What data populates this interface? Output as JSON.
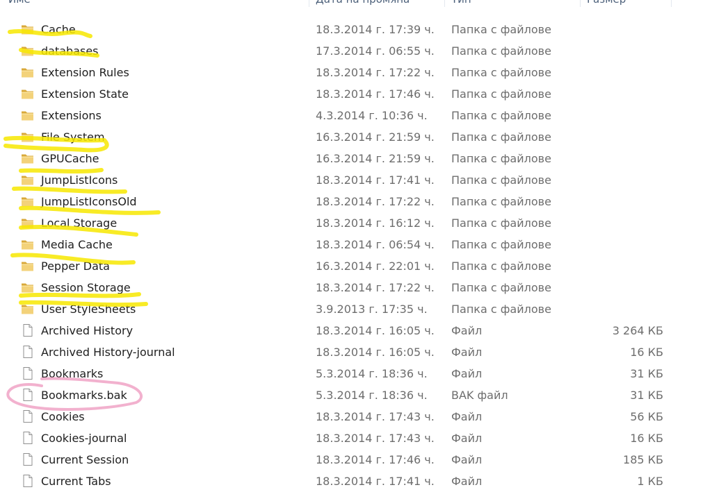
{
  "columns": {
    "name": "Име",
    "date": "Дата на промяна",
    "type": "Тип",
    "size": "Размер"
  },
  "colors": {
    "highlight_yellow": "#f7e700",
    "highlight_pink": "#f0a3c6",
    "folder": "#e8c260",
    "header_text": "#4c607a"
  },
  "files": [
    {
      "name": "Cache",
      "date": "18.3.2014 г. 17:39 ч.",
      "type": "Папка с файлове",
      "size": "",
      "icon": "folder-icon"
    },
    {
      "name": "databases",
      "date": "17.3.2014 г. 06:55 ч.",
      "type": "Папка с файлове",
      "size": "",
      "icon": "folder-icon"
    },
    {
      "name": "Extension Rules",
      "date": "18.3.2014 г. 17:22 ч.",
      "type": "Папка с файлове",
      "size": "",
      "icon": "folder-icon"
    },
    {
      "name": "Extension State",
      "date": "18.3.2014 г. 17:46 ч.",
      "type": "Папка с файлове",
      "size": "",
      "icon": "folder-icon"
    },
    {
      "name": "Extensions",
      "date": "4.3.2014 г. 10:36 ч.",
      "type": "Папка с файлове",
      "size": "",
      "icon": "folder-icon"
    },
    {
      "name": "File System",
      "date": "16.3.2014 г. 21:59 ч.",
      "type": "Папка с файлове",
      "size": "",
      "icon": "folder-icon"
    },
    {
      "name": "GPUCache",
      "date": "16.3.2014 г. 21:59 ч.",
      "type": "Папка с файлове",
      "size": "",
      "icon": "folder-icon"
    },
    {
      "name": "JumpListIcons",
      "date": "18.3.2014 г. 17:41 ч.",
      "type": "Папка с файлове",
      "size": "",
      "icon": "folder-icon"
    },
    {
      "name": "JumpListIconsOld",
      "date": "18.3.2014 г. 17:22 ч.",
      "type": "Папка с файлове",
      "size": "",
      "icon": "folder-icon"
    },
    {
      "name": "Local Storage",
      "date": "18.3.2014 г. 16:12 ч.",
      "type": "Папка с файлове",
      "size": "",
      "icon": "folder-icon"
    },
    {
      "name": "Media Cache",
      "date": "18.3.2014 г. 06:54 ч.",
      "type": "Папка с файлове",
      "size": "",
      "icon": "folder-icon"
    },
    {
      "name": "Pepper Data",
      "date": "16.3.2014 г. 22:01 ч.",
      "type": "Папка с файлове",
      "size": "",
      "icon": "folder-icon"
    },
    {
      "name": "Session Storage",
      "date": "18.3.2014 г. 17:22 ч.",
      "type": "Папка с файлове",
      "size": "",
      "icon": "folder-icon"
    },
    {
      "name": "User StyleSheets",
      "date": "3.9.2013 г. 17:35 ч.",
      "type": "Папка с файлове",
      "size": "",
      "icon": "folder-icon"
    },
    {
      "name": "Archived History",
      "date": "18.3.2014 г. 16:05 ч.",
      "type": "Файл",
      "size": "3 264 КБ",
      "icon": "file-icon"
    },
    {
      "name": "Archived History-journal",
      "date": "18.3.2014 г. 16:05 ч.",
      "type": "Файл",
      "size": "16 КБ",
      "icon": "file-icon"
    },
    {
      "name": "Bookmarks",
      "date": "5.3.2014 г. 18:36 ч.",
      "type": "Файл",
      "size": "31 КБ",
      "icon": "file-icon"
    },
    {
      "name": "Bookmarks.bak",
      "date": "5.3.2014 г. 18:36 ч.",
      "type": "BAK файл",
      "size": "31 КБ",
      "icon": "file-icon"
    },
    {
      "name": "Cookies",
      "date": "18.3.2014 г. 17:43 ч.",
      "type": "Файл",
      "size": "56 КБ",
      "icon": "file-icon"
    },
    {
      "name": "Cookies-journal",
      "date": "18.3.2014 г. 17:43 ч.",
      "type": "Файл",
      "size": "16 КБ",
      "icon": "file-icon"
    },
    {
      "name": "Current Session",
      "date": "18.3.2014 г. 17:46 ч.",
      "type": "Файл",
      "size": "185 КБ",
      "icon": "file-icon"
    },
    {
      "name": "Current Tabs",
      "date": "18.3.2014 г. 17:41 ч.",
      "type": "Файл",
      "size": "1 КБ",
      "icon": "file-icon"
    }
  ]
}
